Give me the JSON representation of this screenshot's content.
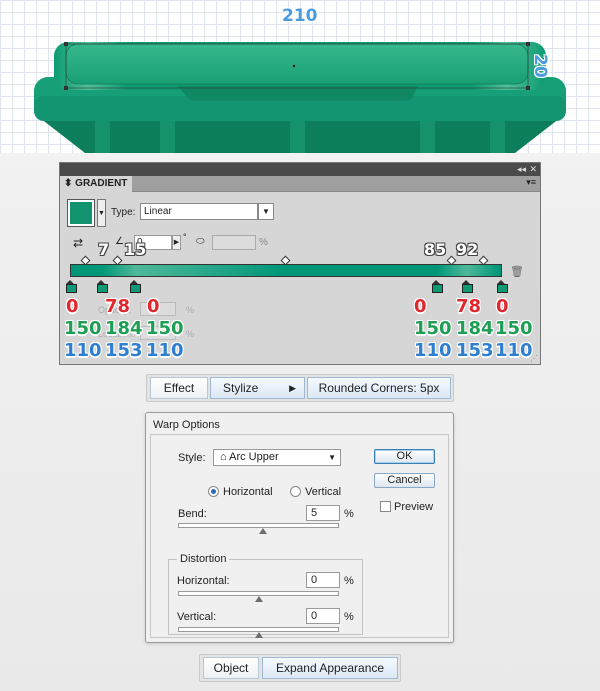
{
  "artboard": {
    "width_label": "210",
    "height_label": "20",
    "lid_color": "#1a9f75",
    "lid_dark": "#0d7f5c"
  },
  "gradient_panel": {
    "tab_label": "GRADIENT",
    "type_label": "Type:",
    "type_value": "Linear",
    "angle_value": "0",
    "degree_symbol": "°",
    "percent": "%",
    "ghost_opacity": "Opacity:",
    "ghost_location": "Location:",
    "location_labels": [
      {
        "text": "7"
      },
      {
        "text": "15"
      },
      {
        "text": "85"
      },
      {
        "text": "92"
      }
    ],
    "colors": {
      "accent": "#13926e",
      "bar_base": "#009678",
      "bar_light": "#4eb899"
    },
    "rgb_left": {
      "r": [
        "0",
        "78",
        "0"
      ],
      "g": [
        "150",
        "184",
        "150"
      ],
      "b": [
        "110",
        "153",
        "110"
      ]
    },
    "rgb_right": {
      "r": [
        "0",
        "78",
        "0"
      ],
      "g": [
        "150",
        "184",
        "150"
      ],
      "b": [
        "110",
        "153",
        "110"
      ]
    }
  },
  "effect_path": {
    "items": [
      "Effect",
      "Stylize",
      "Rounded Corners: 5px"
    ]
  },
  "warp_dialog": {
    "title": "Warp Options",
    "style_label": "Style:",
    "style_value": "Arc Upper",
    "horizontal_label": "Horizontal",
    "vertical_label": "Vertical",
    "selected_orientation": "Horizontal",
    "bend_label": "Bend:",
    "bend_value": "5",
    "percent": "%",
    "distortion_label": "Distortion",
    "dist_horizontal_label": "Horizontal:",
    "dist_horizontal_value": "0",
    "dist_vertical_label": "Vertical:",
    "dist_vertical_value": "0",
    "ok_label": "OK",
    "cancel_label": "Cancel",
    "preview_label": "Preview",
    "preview_checked": false,
    "bend_slider_fraction": 0.525,
    "dist_h_slider_fraction": 0.5,
    "dist_v_slider_fraction": 0.5
  },
  "object_path": {
    "items": [
      "Object",
      "Expand Appearance"
    ]
  }
}
